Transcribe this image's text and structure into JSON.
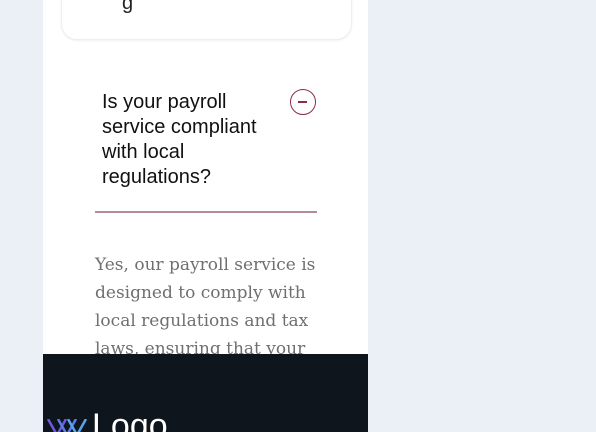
{
  "faq": {
    "prev_fragment": "g",
    "question": "Is your payroll service compliant with local regulations?",
    "answer": "Yes, our payroll service is designed to comply with local regulations and tax laws, ensuring that your",
    "toggle_icon": "minus-circle-icon",
    "accent_color": "#8c2a52"
  },
  "footer": {
    "logo_text": "Logo",
    "logo_icon": "logo-mark-icon",
    "background_color": "#0f151c"
  }
}
